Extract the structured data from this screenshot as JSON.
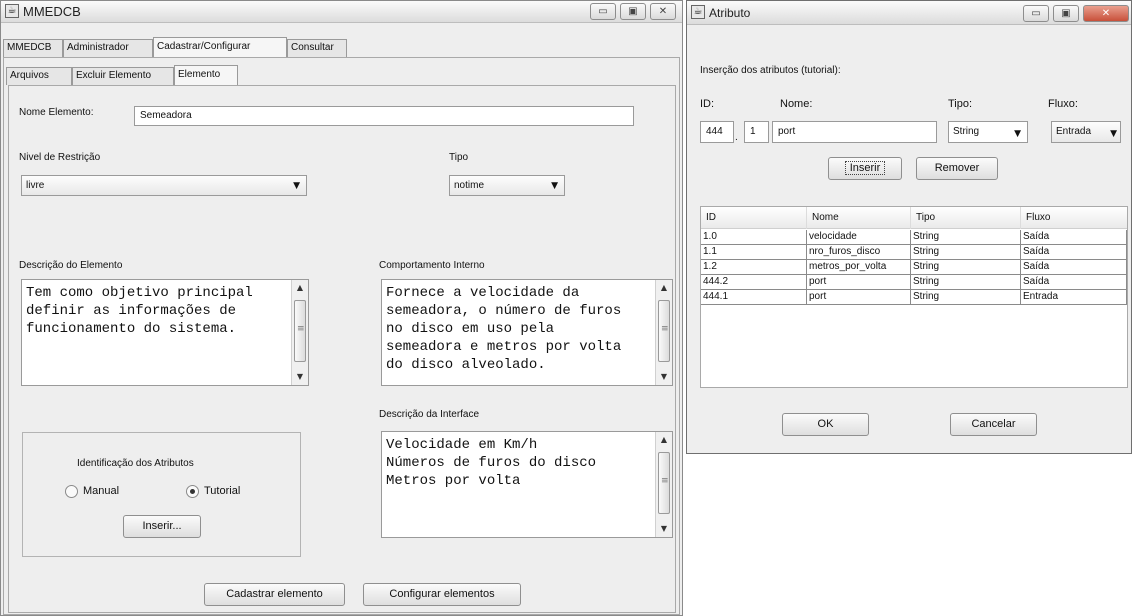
{
  "main_window": {
    "title": "MMEDCB",
    "title_icon": "java-cup-icon",
    "controls": {
      "minimize": "▭",
      "maximize": "▣",
      "close": "✕"
    },
    "menu_tabs": [
      "MMEDCB",
      "Administrador",
      "Cadastrar/Configurar",
      "Consultar"
    ],
    "sub_tabs": [
      "Arquivos",
      "Excluir Elemento",
      "Elemento"
    ],
    "form": {
      "nome_label": "Nome Elemento:",
      "nome_value": "Semeadora",
      "restricao_label": "Nivel de Restrição",
      "restricao_value": "livre",
      "tipo_label": "Tipo",
      "tipo_value": "notime",
      "descricao_label": "Descrição do Elemento",
      "descricao_value": "Tem como objetivo principal\ndefinir as informações de\nfuncionamento do sistema.",
      "comportamento_label": "Comportamento Interno",
      "comportamento_value": "Fornece a velocidade da\nsemeadora, o número de furos\nno disco em uso pela\nsemeadora e metros por volta\ndo disco alveolado.",
      "interface_label": "Descrição da Interface",
      "interface_value": "Velocidade em Km/h\nNúmeros de furos do disco\nMetros por volta",
      "atributos_group_label": "Identificação dos Atributos",
      "radio_manual": "Manual",
      "radio_tutorial": "Tutorial",
      "inserir_button": "Inserir...",
      "cadastrar_button": "Cadastrar elemento",
      "configurar_button": "Configurar elementos"
    }
  },
  "attr_window": {
    "title": "Atributo",
    "title_icon": "java-cup-icon",
    "heading": "Inserção dos atributos (tutorial):",
    "id_label": "ID:",
    "nome_label": "Nome:",
    "tipo_label": "Tipo:",
    "fluxo_label": "Fluxo:",
    "id_value": "444",
    "id_sep": ".",
    "sub_id_value": "1",
    "nome_value": "port",
    "tipo_value": "String",
    "fluxo_value": "Entrada",
    "inserir_button": "Inserir",
    "remover_button": "Remover",
    "table": {
      "columns": [
        "ID",
        "Nome",
        "Tipo",
        "Fluxo"
      ],
      "rows": [
        [
          "1.0",
          "velocidade",
          "String",
          "Saída"
        ],
        [
          "1.1",
          "nro_furos_disco",
          "String",
          "Saída"
        ],
        [
          "1.2",
          "metros_por_volta",
          "String",
          "Saída"
        ],
        [
          "444.2",
          "port",
          "String",
          "Saída"
        ],
        [
          "444.1",
          "port",
          "String",
          "Entrada"
        ]
      ]
    },
    "ok_button": "OK",
    "cancelar_button": "Cancelar"
  }
}
